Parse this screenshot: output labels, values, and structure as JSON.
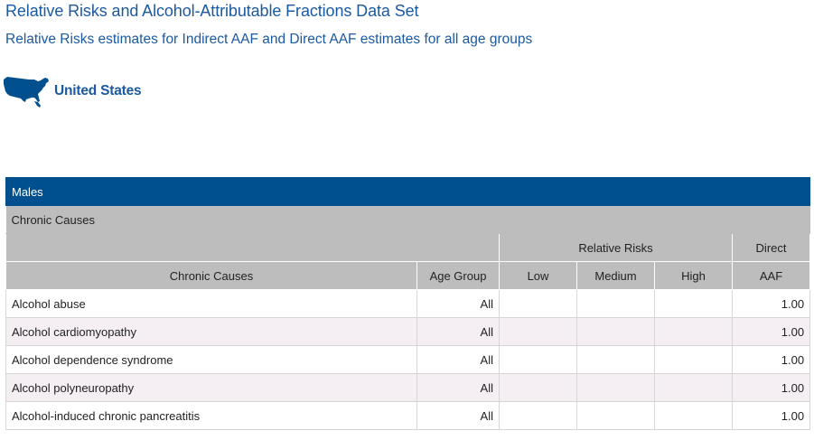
{
  "header": {
    "title": "Relative Risks and Alcohol-Attributable Fractions Data Set",
    "subtitle": "Relative Risks estimates for Indirect AAF and Direct AAF estimates for all age groups",
    "region_icon": "us-map-icon",
    "region_name": "United States"
  },
  "table": {
    "section_label": "Males",
    "cause_type_label": "Chronic Causes",
    "group_headers": {
      "relative_risks": "Relative Risks",
      "direct": "Direct"
    },
    "columns": {
      "cause": "Chronic Causes",
      "age_group": "Age Group",
      "low": "Low",
      "medium": "Medium",
      "high": "High",
      "aaf": "AAF"
    },
    "rows": [
      {
        "cause": "Alcohol abuse",
        "age_group": "All",
        "low": "",
        "medium": "",
        "high": "",
        "aaf": "1.00"
      },
      {
        "cause": "Alcohol cardiomyopathy",
        "age_group": "All",
        "low": "",
        "medium": "",
        "high": "",
        "aaf": "1.00"
      },
      {
        "cause": "Alcohol dependence syndrome",
        "age_group": "All",
        "low": "",
        "medium": "",
        "high": "",
        "aaf": "1.00"
      },
      {
        "cause": "Alcohol polyneuropathy",
        "age_group": "All",
        "low": "",
        "medium": "",
        "high": "",
        "aaf": "1.00"
      },
      {
        "cause": "Alcohol-induced chronic pancreatitis",
        "age_group": "All",
        "low": "",
        "medium": "",
        "high": "",
        "aaf": "1.00"
      }
    ]
  },
  "colors": {
    "heading_blue": "#1b5aa0",
    "header_bar": "#00508f",
    "header_grey": "#bdbdbd",
    "alt_row": "#f5eef2"
  }
}
